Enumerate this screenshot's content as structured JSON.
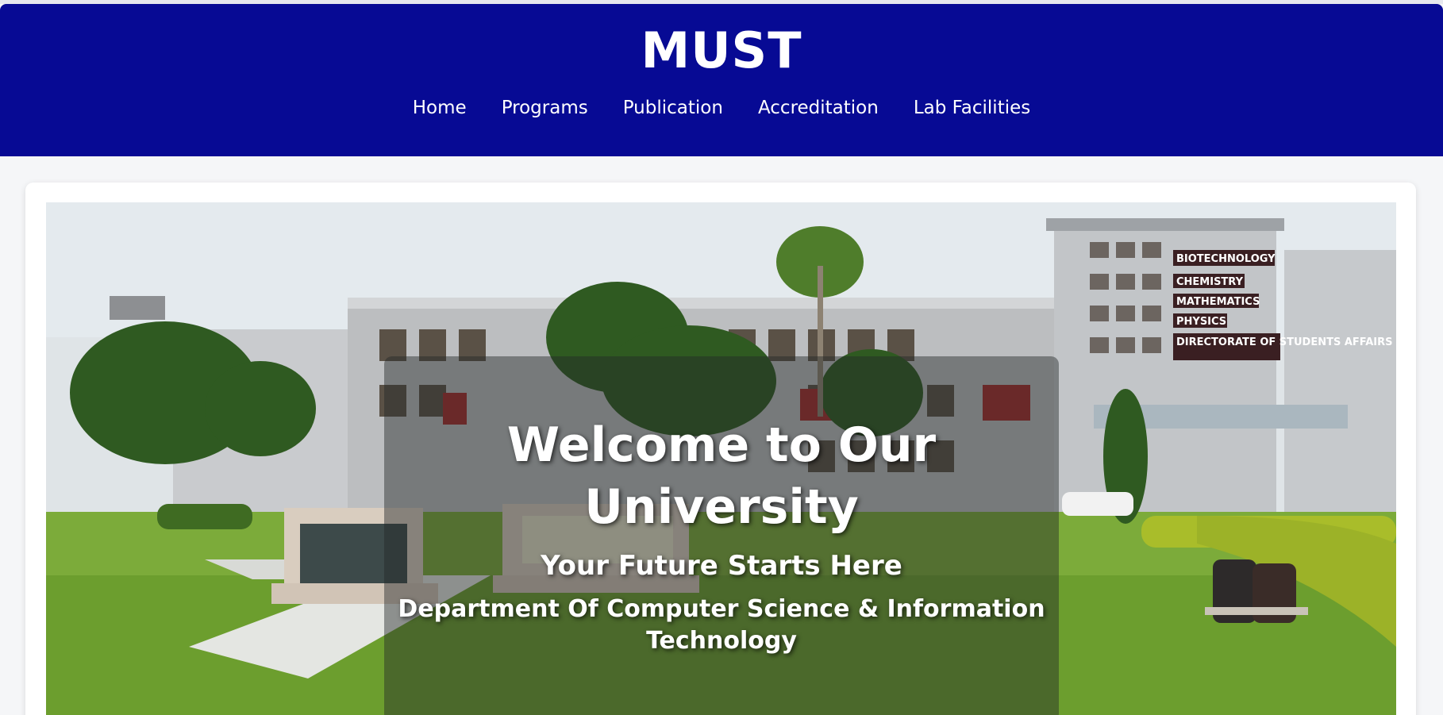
{
  "header": {
    "brand": "MUST",
    "nav": [
      {
        "label": "Home"
      },
      {
        "label": "Programs"
      },
      {
        "label": "Publication"
      },
      {
        "label": "Accreditation"
      },
      {
        "label": "Lab Facilities"
      }
    ]
  },
  "hero": {
    "headline": "Welcome to Our University",
    "tagline": "Your Future Starts Here",
    "department": "Department Of Computer Science & Information Technology",
    "building_signs": [
      "BIOTECHNOLOGY",
      "CHEMISTRY",
      "MATHEMATICS",
      "PHYSICS",
      "DIRECTORATE OF STUDENTS AFFAIRS"
    ]
  },
  "colors": {
    "header_bg": "#070a94",
    "header_text": "#ffffff",
    "overlay": "rgba(35,40,40,0.45)"
  }
}
